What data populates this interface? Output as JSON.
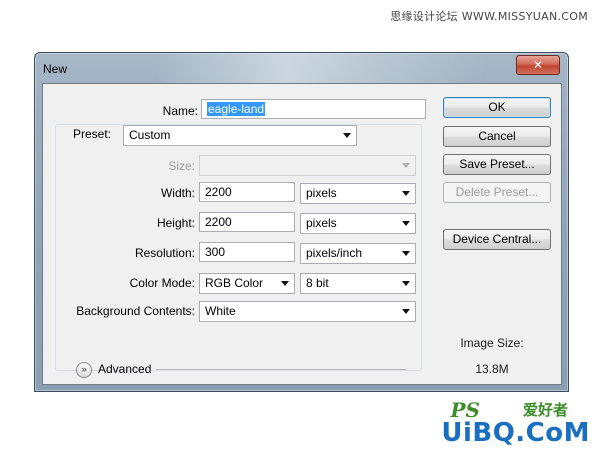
{
  "watermark": {
    "top_text": "思缘设计论坛 WWW.MISSYUAN.COM",
    "logo_ps": "PS",
    "logo_cn": "爱好者",
    "logo_site": "UiBQ.CoM"
  },
  "window": {
    "title": "New",
    "close_glyph": "✕"
  },
  "form": {
    "name_label": "Name:",
    "name_value": "eagle-land",
    "preset_label": "Preset:",
    "preset_value": "Custom",
    "size_label": "Size:",
    "size_value": "",
    "width_label": "Width:",
    "width_value": "2200",
    "width_unit": "pixels",
    "height_label": "Height:",
    "height_value": "2200",
    "height_unit": "pixels",
    "resolution_label": "Resolution:",
    "resolution_value": "300",
    "resolution_unit": "pixels/inch",
    "color_mode_label": "Color Mode:",
    "color_mode_value": "RGB Color",
    "bit_depth_value": "8 bit",
    "background_label": "Background Contents:",
    "background_value": "White",
    "advanced_label": "Advanced"
  },
  "buttons": {
    "ok": "OK",
    "cancel": "Cancel",
    "save_preset": "Save Preset...",
    "delete_preset": "Delete Preset...",
    "device_central": "Device Central..."
  },
  "image_size": {
    "label": "Image Size:",
    "value": "13.8M"
  },
  "icons": {
    "close": "close-icon",
    "advanced_toggle": "expand-toggle-icon",
    "dropdown": "chevron-down-icon"
  }
}
